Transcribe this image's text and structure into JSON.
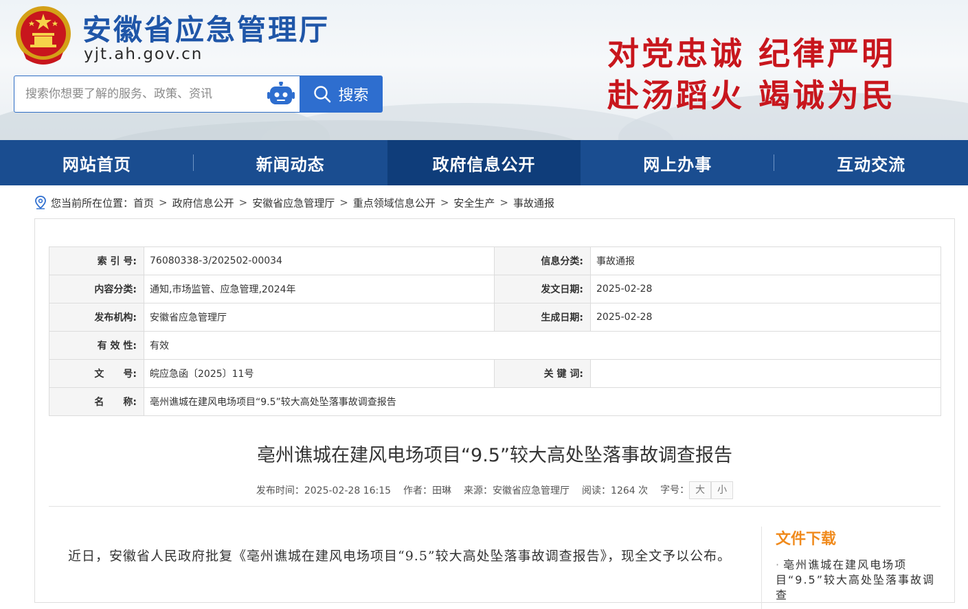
{
  "header": {
    "site_title": "安徽省应急管理厅",
    "site_domain": "yjt.ah.gov.cn",
    "slogan_line1": "对党忠诚  纪律严明",
    "slogan_line2": "赴汤蹈火  竭诚为民",
    "search_placeholder": "搜索你想要了解的服务、政策、资讯",
    "search_button": "搜索",
    "emblem_icon": "national-emblem-icon",
    "robot_icon": "robot-icon"
  },
  "nav": {
    "items": [
      "网站首页",
      "新闻动态",
      "政府信息公开",
      "网上办事",
      "互动交流"
    ],
    "active_index": 2
  },
  "breadcrumb": {
    "prefix": "您当前所在位置：",
    "items": [
      "首页",
      "政府信息公开",
      "安徽省应急管理厅",
      "重点领域信息公开",
      "安全生产",
      "事故通报"
    ]
  },
  "meta": {
    "index_label": "索 引 号:",
    "index_value": "76080338-3/202502-00034",
    "info_category_label": "信息分类:",
    "info_category_value": "事故通报",
    "content_category_label": "内容分类:",
    "content_category_value": "通知,市场监管、应急管理,2024年",
    "issue_date_label": "发文日期:",
    "issue_date_value": "2025-02-28",
    "publisher_label": "发布机构:",
    "publisher_value": "安徽省应急管理厅",
    "generated_date_label": "生成日期:",
    "generated_date_value": "2025-02-28",
    "validity_label": "有 效 性:",
    "validity_value": "有效",
    "doc_number_label": "文　　号:",
    "doc_number_value": "皖应急函〔2025〕11号",
    "keywords_label": "关 键 词:",
    "keywords_value": "",
    "name_label": "名　　称:",
    "name_value": "亳州谯城在建风电场项目“9.5”较大高处坠落事故调查报告"
  },
  "article": {
    "title": "亳州谯城在建风电场项目“9.5”较大高处坠落事故调查报告",
    "publish_time": "发布时间：2025-02-28 16:15",
    "author": "作者：田琳",
    "source": "来源：安徽省应急管理厅",
    "views": "阅读：1264 次",
    "font_size_label": "字号：",
    "font_large": "大",
    "font_small": "小",
    "intro": "近日，安徽省人民政府批复《亳州谯城在建风电场项目“9.5”较大高处坠落事故调查报告》，现全文予以公布。"
  },
  "downloads": {
    "title": "文件下载",
    "items": [
      "亳州谯城在建风电场项目“9.5”较大高处坠落事故调查"
    ]
  },
  "colors": {
    "nav_bg": "#1a4d90",
    "nav_active": "#0f3d7a",
    "title_blue": "#1f56a8",
    "slogan_red": "#c8161d",
    "download_orange": "#f08a1c"
  }
}
